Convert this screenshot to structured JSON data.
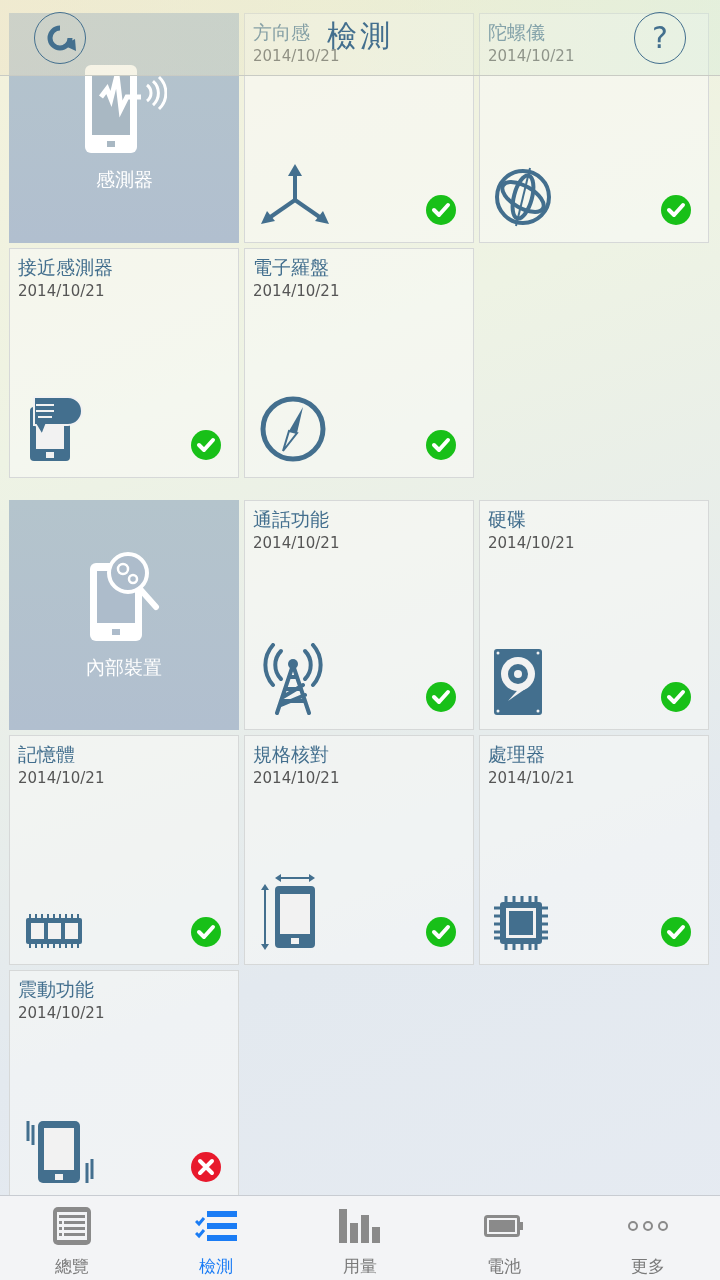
{
  "header": {
    "title": "檢測",
    "help_label": "?"
  },
  "sections": [
    {
      "category": {
        "label": "感測器",
        "kind": "sensor"
      },
      "tests": [
        {
          "name": "方向感",
          "date": "2014/10/21",
          "kind": "axes",
          "passed": true
        },
        {
          "name": "陀螺儀",
          "date": "2014/10/21",
          "kind": "gyroscope",
          "passed": true
        },
        {
          "name": "接近感測器",
          "date": "2014/10/21",
          "kind": "proximity",
          "passed": true
        },
        {
          "name": "電子羅盤",
          "date": "2014/10/21",
          "kind": "compass",
          "passed": true
        }
      ]
    },
    {
      "category": {
        "label": "內部裝置",
        "kind": "internal"
      },
      "tests": [
        {
          "name": "通話功能",
          "date": "2014/10/21",
          "kind": "antenna",
          "passed": true
        },
        {
          "name": "硬碟",
          "date": "2014/10/21",
          "kind": "disk",
          "passed": true
        },
        {
          "name": "記憶體",
          "date": "2014/10/21",
          "kind": "memory",
          "passed": true
        },
        {
          "name": "規格核對",
          "date": "2014/10/21",
          "kind": "resize",
          "passed": true
        },
        {
          "name": "處理器",
          "date": "2014/10/21",
          "kind": "cpu",
          "passed": true
        },
        {
          "name": "震動功能",
          "date": "2014/10/21",
          "kind": "vibrate",
          "passed": false
        }
      ]
    }
  ],
  "tabs": [
    {
      "label": "總覽",
      "kind": "overview",
      "selected": false
    },
    {
      "label": "檢測",
      "kind": "checklist",
      "selected": true
    },
    {
      "label": "用量",
      "kind": "bars",
      "selected": false
    },
    {
      "label": "電池",
      "kind": "battery",
      "selected": false
    },
    {
      "label": "更多",
      "kind": "more",
      "selected": false
    }
  ]
}
